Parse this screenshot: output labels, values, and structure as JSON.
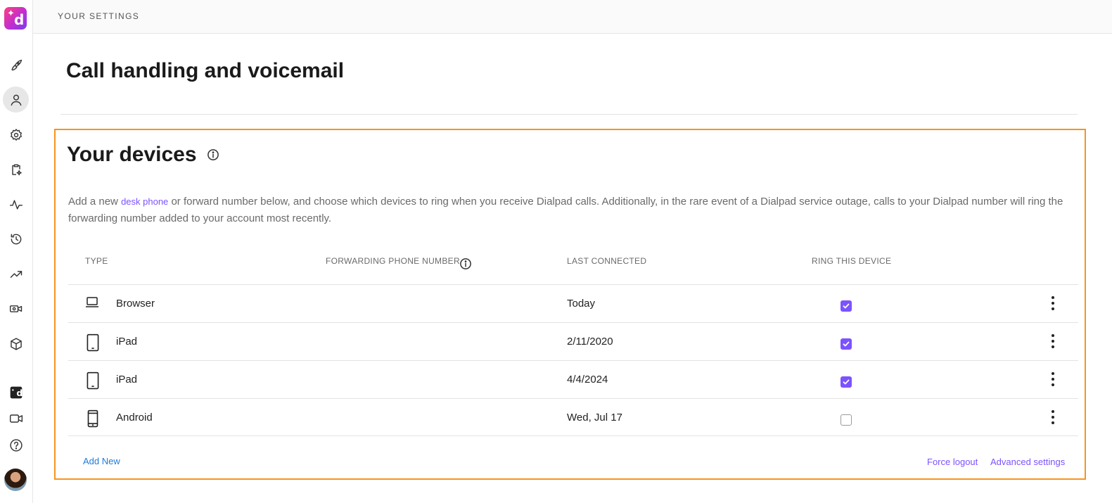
{
  "header": {
    "breadcrumb": "YOUR SETTINGS"
  },
  "page": {
    "title": "Call handling and voicemail"
  },
  "rail": {
    "icons": [
      "dialpad-logo",
      "rocket-icon",
      "user-icon",
      "gear-icon",
      "clipboard-sparkle-icon",
      "activity-icon",
      "history-icon",
      "trending-icon",
      "video-camera-settings-icon",
      "cube-icon",
      "dialpad-app-icon",
      "video-icon",
      "help-icon",
      "avatar"
    ],
    "active": "user-icon"
  },
  "devices": {
    "title": "Your devices",
    "description_before": "Add a new ",
    "description_link": "desk phone",
    "description_after": " or forward number below, and choose which devices to ring when you receive Dialpad calls. Additionally, in the rare event of a Dialpad service outage, calls to your Dialpad number will ring the forwarding number added to your account most recently.",
    "columns": {
      "type": "TYPE",
      "forwarding": "FORWARDING PHONE NUMBER",
      "last_connected": "LAST CONNECTED",
      "ring": "RING THIS DEVICE"
    },
    "rows": [
      {
        "icon": "laptop-icon",
        "type": "Browser",
        "forwarding": "",
        "last_connected": "Today",
        "ring": true
      },
      {
        "icon": "tablet-icon",
        "type": "iPad",
        "forwarding": "",
        "last_connected": "2/11/2020",
        "ring": true
      },
      {
        "icon": "tablet-icon",
        "type": "iPad",
        "forwarding": "",
        "last_connected": "4/4/2024",
        "ring": true
      },
      {
        "icon": "mobile-phone-icon",
        "type": "Android",
        "forwarding": "",
        "last_connected": "Wed, Jul 17",
        "ring": false
      }
    ],
    "add_new": "Add New",
    "force_logout": "Force logout",
    "advanced_settings": "Advanced settings"
  },
  "colors": {
    "accent": "#7c52ff",
    "link_blue": "#1f7bd8",
    "highlight_border": "#f7941d"
  }
}
